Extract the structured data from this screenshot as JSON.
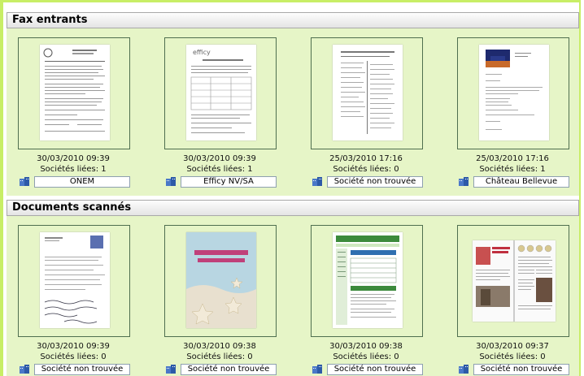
{
  "sections": [
    {
      "title": "Fax entrants",
      "items": [
        {
          "date": "30/03/2010 09:39",
          "linked": "Sociétés liées: 1",
          "company": "ONEM",
          "thumb": "fax-doc"
        },
        {
          "date": "30/03/2010 09:39",
          "linked": "Sociétés liées: 1",
          "company": "Efficy NV/SA",
          "thumb": "fax-doc"
        },
        {
          "date": "25/03/2010 17:16",
          "linked": "Sociétés liées: 0",
          "company": "Société non trouvée",
          "thumb": "fax-doc"
        },
        {
          "date": "25/03/2010 17:16",
          "linked": "Sociétés liées: 1",
          "company": "Château Bellevue",
          "thumb": "letter-doc"
        }
      ]
    },
    {
      "title": "Documents scannés",
      "items": [
        {
          "date": "30/03/2010 09:39",
          "linked": "Sociétés liées: 0",
          "company": "Société non trouvée",
          "thumb": "scan-form"
        },
        {
          "date": "30/03/2010 09:38",
          "linked": "Sociétés liées: 0",
          "company": "Société non trouvée",
          "thumb": "scan-poster"
        },
        {
          "date": "30/03/2010 09:38",
          "linked": "Sociétés liées: 0",
          "company": "Société non trouvée",
          "thumb": "scan-web"
        },
        {
          "date": "30/03/2010 09:37",
          "linked": "Sociétés liées: 0",
          "company": "Société non trouvée",
          "thumb": "scan-magazine"
        }
      ]
    }
  ],
  "colors": {
    "frame": "#c8ee66",
    "section_body": "#e6f5c7",
    "thumb_border": "#4f6f4f"
  },
  "icons": {
    "company": "company-building-icon"
  }
}
